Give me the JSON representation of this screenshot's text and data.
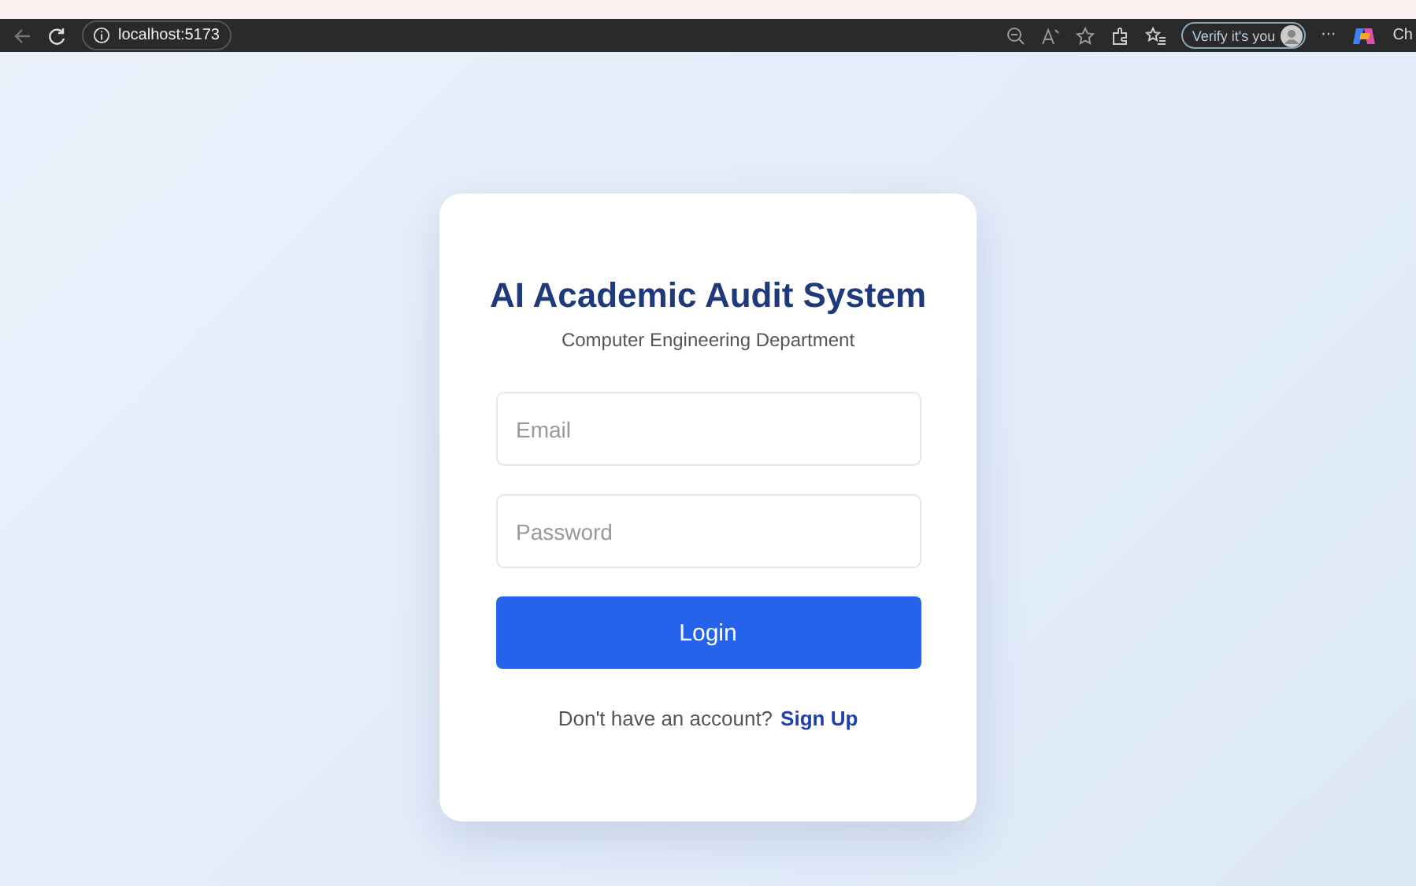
{
  "browser": {
    "url": "localhost:5173",
    "profile_button": "Verify it's you",
    "more": "···",
    "copilot_label": "Ch"
  },
  "login": {
    "title": "AI Academic Audit System",
    "subtitle": "Computer Engineering Department",
    "fields": [
      {
        "placeholder": "Email"
      },
      {
        "placeholder": "Password"
      }
    ],
    "button": "Login",
    "prompt": "Don't have an account?",
    "link": "Sign Up"
  }
}
